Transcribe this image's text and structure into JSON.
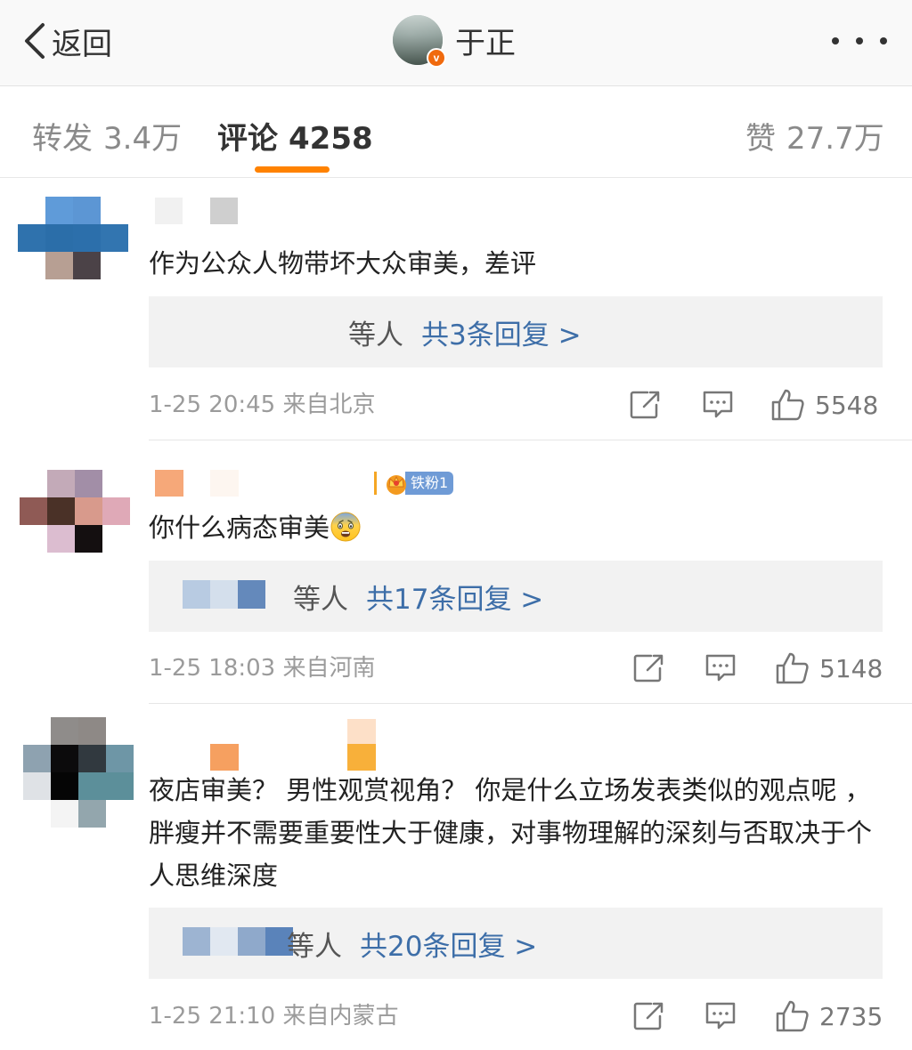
{
  "nav": {
    "back_label": "返回",
    "author_name": "于正",
    "verified_mark": "v"
  },
  "tabs": {
    "repost": {
      "label": "转发",
      "count": "3.4万"
    },
    "comment": {
      "label": "评论",
      "count": "4258"
    },
    "like": {
      "label": "赞",
      "count": "27.7万"
    }
  },
  "colors": {
    "accent": "#ff8200",
    "link": "#3d6ea8",
    "meta_gray": "#9b9b9b",
    "fan_badge": "#6f9bd6"
  },
  "icons": [
    "chevron-left-icon",
    "more-icon",
    "share-icon",
    "comment-icon",
    "thumbs-up-icon",
    "crown-icon",
    "fearful-face-emoji"
  ],
  "comments": [
    {
      "text": "作为公众人物带坏大众审美，差评",
      "reply_who": "等人",
      "reply_count": "共3条回复 >",
      "time": "1-25 20:45",
      "location": "来自北京",
      "likes": "5548"
    },
    {
      "text": "你什么病态审美",
      "fan_badge": "铁粉1",
      "reply_who": "等人",
      "reply_count": "共17条回复 >",
      "time": "1-25 18:03",
      "location": "来自河南",
      "likes": "5148"
    },
    {
      "text": "夜店审美？ 男性观赏视角？ 你是什么立场发表类似的观点呢 ，胖瘦并不需要重要性大于健康，对事物理解的深刻与否取决于个人思维深度",
      "reply_who": "等人",
      "reply_count": "共20条回复 >",
      "time": "1-25 21:10",
      "location": "来自内蒙古",
      "likes": "2735"
    }
  ]
}
